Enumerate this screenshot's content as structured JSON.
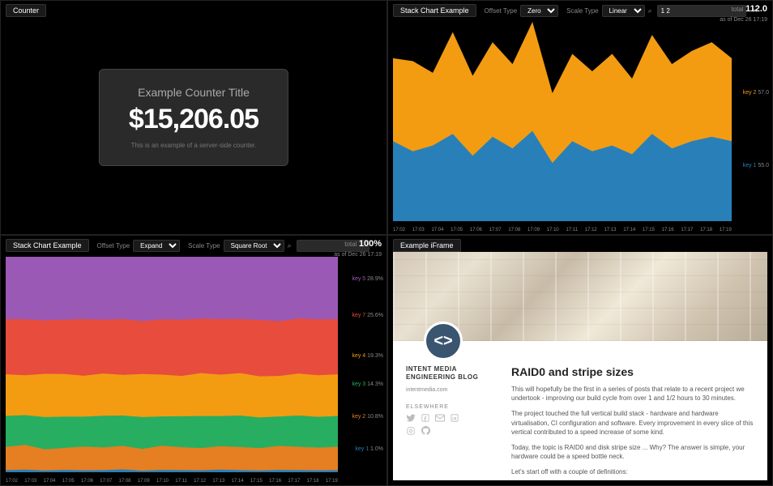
{
  "panels": {
    "counter": {
      "header": "Counter",
      "title": "Example Counter Title",
      "value": "$15,206.05",
      "subtitle": "This is an example of a server-side counter."
    },
    "stack1": {
      "header": "Stack Chart Example",
      "offset_label": "Offset Type",
      "offset_value": "Zero",
      "scale_label": "Scale Type",
      "scale_value": "Linear",
      "search_value": "1 2",
      "total_label": "total",
      "total_value": "112.0",
      "total_asof": "as of Dec 26 17:19",
      "legend": [
        {
          "key": "key 2",
          "val": "57.0",
          "color": "#f39c12"
        },
        {
          "key": "key 1",
          "val": "55.0",
          "color": "#2980b9"
        }
      ],
      "xticks": [
        "17:02",
        "17:03",
        "17:04",
        "17:05",
        "17:06",
        "17:07",
        "17:08",
        "17:09",
        "17:10",
        "17:11",
        "17:12",
        "17:13",
        "17:14",
        "17:15",
        "17:16",
        "17:17",
        "17:18",
        "17:19"
      ]
    },
    "stack2": {
      "header": "Stack Chart Example",
      "offset_label": "Offset Type",
      "offset_value": "Expand",
      "scale_label": "Scale Type",
      "scale_value": "Square Root",
      "total_label": "total",
      "total_value": "100%",
      "total_asof": "as of Dec 26 17:19",
      "legend": [
        {
          "key": "key 5",
          "val": "28.9%",
          "color": "#9b59b6"
        },
        {
          "key": "key 7",
          "val": "25.6%",
          "color": "#e74c3c"
        },
        {
          "key": "key 4",
          "val": "19.3%",
          "color": "#f39c12"
        },
        {
          "key": "key 3",
          "val": "14.3%",
          "color": "#27ae60"
        },
        {
          "key": "key 2",
          "val": "10.8%",
          "color": "#e67e22"
        },
        {
          "key": "key 1",
          "val": "1.0%",
          "color": "#2980b9"
        }
      ],
      "xticks": [
        "17:02",
        "17:03",
        "17:04",
        "17:05",
        "17:06",
        "17:07",
        "17:08",
        "17:09",
        "17:10",
        "17:11",
        "17:12",
        "17:13",
        "17:14",
        "17:15",
        "17:16",
        "17:17",
        "17:18",
        "17:19"
      ]
    },
    "iframe": {
      "header": "Example iFrame",
      "side_title": "INTENT MEDIA ENGINEERING BLOG",
      "side_link": "intentmedia.com",
      "elsewhere": "ELSEWHERE",
      "post_title": "RAID0 and stripe sizes",
      "p1": "This will hopefully be the first in a series of posts that relate to a recent project we undertook - improving our build cycle from over 1 and 1/2 hours to 30 minutes.",
      "p2": "The project touched the full vertical build stack - hardware and hardware virtualisation, CI configuration and software. Every improvement in every slice of this vertical contributed to a speed increase of some kind.",
      "p3": "Today, the topic is RAID0 and disk stripe size ... Why? The answer is simple, your hardware could be a speed bottle neck.",
      "p4": "Let's start off with a couple of definitions:"
    }
  },
  "chart_data": [
    {
      "type": "area",
      "title": "Stack Chart Example (Zero / Linear)",
      "x": [
        "17:02",
        "17:03",
        "17:04",
        "17:05",
        "17:06",
        "17:07",
        "17:08",
        "17:09",
        "17:10",
        "17:11",
        "17:12",
        "17:13",
        "17:14",
        "17:15",
        "17:16",
        "17:17",
        "17:18",
        "17:19"
      ],
      "series": [
        {
          "name": "key 1",
          "color": "#2980b9",
          "values": [
            55,
            48,
            52,
            60,
            45,
            58,
            50,
            62,
            40,
            55,
            48,
            52,
            46,
            60,
            50,
            55,
            58,
            55
          ]
        },
        {
          "name": "key 2",
          "color": "#f39c12",
          "values": [
            57,
            62,
            50,
            70,
            55,
            65,
            58,
            75,
            48,
            60,
            55,
            63,
            52,
            68,
            58,
            62,
            65,
            57
          ]
        }
      ],
      "ylim": [
        0,
        140
      ],
      "stacked": true
    },
    {
      "type": "area",
      "title": "Stack Chart Example (Expand / Square Root)",
      "x": [
        "17:02",
        "17:03",
        "17:04",
        "17:05",
        "17:06",
        "17:07",
        "17:08",
        "17:09",
        "17:10",
        "17:11",
        "17:12",
        "17:13",
        "17:14",
        "17:15",
        "17:16",
        "17:17",
        "17:18",
        "17:19"
      ],
      "series": [
        {
          "name": "key 1",
          "color": "#2980b9",
          "values": [
            1.0,
            1.2,
            0.8,
            1.1,
            0.9,
            1.0,
            1.3,
            0.7,
            1.1,
            1.0,
            0.9,
            1.2,
            1.0,
            0.8,
            1.1,
            1.0,
            0.9,
            1.0
          ]
        },
        {
          "name": "key 2",
          "color": "#e67e22",
          "values": [
            10.8,
            11.5,
            9.8,
            10.2,
            11.0,
            10.5,
            10.9,
            10.1,
            11.2,
            10.6,
            10.3,
            10.9,
            10.7,
            10.4,
            11.1,
            10.8,
            10.5,
            10.8
          ]
        },
        {
          "name": "key 3",
          "color": "#27ae60",
          "values": [
            14.3,
            13.8,
            15.0,
            14.5,
            13.9,
            14.7,
            14.1,
            14.8,
            13.6,
            14.4,
            14.9,
            14.0,
            14.6,
            14.2,
            13.7,
            14.5,
            14.3,
            14.3
          ]
        },
        {
          "name": "key 4",
          "color": "#f39c12",
          "values": [
            19.3,
            18.5,
            20.1,
            19.8,
            19.0,
            19.6,
            18.9,
            20.0,
            19.4,
            18.7,
            19.9,
            19.2,
            19.7,
            19.1,
            18.8,
            19.5,
            19.3,
            19.3
          ]
        },
        {
          "name": "key 7",
          "color": "#e74c3c",
          "values": [
            25.6,
            26.0,
            24.8,
            25.2,
            26.3,
            25.0,
            25.9,
            24.5,
            25.7,
            26.1,
            25.3,
            25.8,
            25.1,
            26.2,
            25.4,
            25.6,
            25.9,
            25.6
          ]
        },
        {
          "name": "key 5",
          "color": "#9b59b6",
          "values": [
            28.9,
            29.0,
            29.5,
            29.2,
            28.9,
            29.2,
            28.9,
            29.9,
            29.0,
            29.2,
            28.7,
            28.9,
            28.9,
            29.3,
            29.9,
            28.6,
            29.1,
            28.9
          ]
        }
      ],
      "ylim": [
        0,
        100
      ],
      "stacked": true,
      "normalized": true
    }
  ]
}
